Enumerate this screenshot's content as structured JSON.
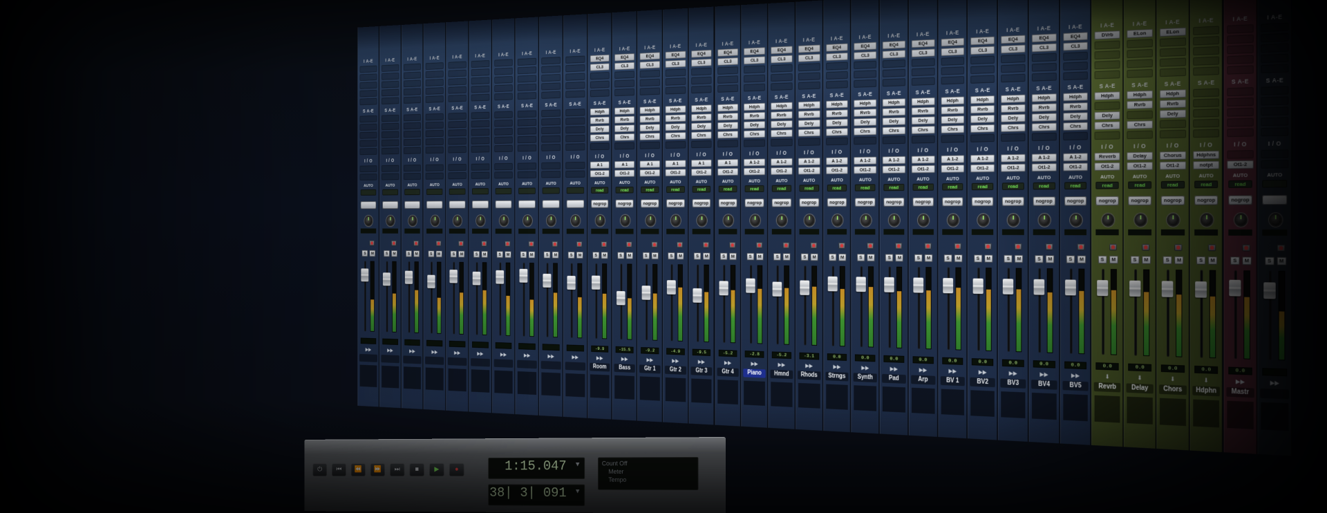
{
  "mixer": {
    "section_labels": {
      "inserts": "I A-E",
      "sends": "S A-E",
      "io": "I / O",
      "auto": "AUTO",
      "solo": "S",
      "mute": "M"
    },
    "channels": [
      {
        "name": "",
        "kind": "audio",
        "inserts": [],
        "sends": [],
        "io_in": "",
        "io_out": "",
        "auto": "",
        "group": "",
        "volume": "",
        "meter": 0.45,
        "fader": 0.8,
        "selected": false
      },
      {
        "name": "",
        "kind": "audio",
        "inserts": [],
        "sends": [],
        "io_in": "",
        "io_out": "",
        "auto": "",
        "group": "",
        "volume": "",
        "meter": 0.55,
        "fader": 0.75,
        "selected": false
      },
      {
        "name": "",
        "kind": "audio",
        "inserts": [],
        "sends": [],
        "io_in": "",
        "io_out": "",
        "auto": "",
        "group": "",
        "volume": "",
        "meter": 0.6,
        "fader": 0.78,
        "selected": false
      },
      {
        "name": "",
        "kind": "audio",
        "inserts": [],
        "sends": [],
        "io_in": "",
        "io_out": "",
        "auto": "",
        "group": "",
        "volume": "",
        "meter": 0.5,
        "fader": 0.72,
        "selected": false
      },
      {
        "name": "",
        "kind": "audio",
        "inserts": [],
        "sends": [],
        "io_in": "",
        "io_out": "",
        "auto": "",
        "group": "",
        "volume": "",
        "meter": 0.58,
        "fader": 0.8,
        "selected": false
      },
      {
        "name": "",
        "kind": "audio",
        "inserts": [],
        "sends": [],
        "io_in": "",
        "io_out": "",
        "auto": "",
        "group": "",
        "volume": "",
        "meter": 0.62,
        "fader": 0.78,
        "selected": false
      },
      {
        "name": "",
        "kind": "audio",
        "inserts": [],
        "sends": [],
        "io_in": "",
        "io_out": "",
        "auto": "",
        "group": "",
        "volume": "",
        "meter": 0.55,
        "fader": 0.8,
        "selected": false
      },
      {
        "name": "",
        "kind": "audio",
        "inserts": [],
        "sends": [],
        "io_in": "",
        "io_out": "",
        "auto": "",
        "group": "",
        "volume": "",
        "meter": 0.5,
        "fader": 0.82,
        "selected": false
      },
      {
        "name": "",
        "kind": "audio",
        "inserts": [],
        "sends": [],
        "io_in": "",
        "io_out": "",
        "auto": "",
        "group": "",
        "volume": "",
        "meter": 0.6,
        "fader": 0.76,
        "selected": false
      },
      {
        "name": "",
        "kind": "audio",
        "inserts": [],
        "sends": [],
        "io_in": "",
        "io_out": "",
        "auto": "",
        "group": "",
        "volume": "",
        "meter": 0.55,
        "fader": 0.74,
        "selected": false
      },
      {
        "name": "Room",
        "kind": "audio",
        "inserts": [
          "EQ4",
          "CL3"
        ],
        "sends": [
          "Hdph",
          "Rvrb",
          "Dely",
          "Chrs"
        ],
        "io_in": "A 1",
        "io_out": "Ot1-2",
        "auto": "read",
        "group": "nogrop",
        "volume": "-9.9",
        "meter": 0.6,
        "fader": 0.75,
        "selected": false
      },
      {
        "name": "Bass",
        "kind": "audio",
        "inserts": [
          "EQ4",
          "CL3"
        ],
        "sends": [
          "Hdph",
          "Rvrb",
          "Dely",
          "Chrs"
        ],
        "io_in": "A 1",
        "io_out": "Ot1-2",
        "auto": "read",
        "group": "nogrop",
        "volume": "-15.5",
        "meter": 0.55,
        "fader": 0.55,
        "selected": false
      },
      {
        "name": "Gtr 1",
        "kind": "audio",
        "inserts": [
          "EQ4",
          "CL3"
        ],
        "sends": [
          "Hdph",
          "Rvrb",
          "Dely",
          "Chrs"
        ],
        "io_in": "A 1",
        "io_out": "Ot1-2",
        "auto": "read",
        "group": "nogrop",
        "volume": "-9.2",
        "meter": 0.62,
        "fader": 0.62,
        "selected": false
      },
      {
        "name": "Gtr 2",
        "kind": "audio",
        "inserts": [
          "EQ4",
          "CL3"
        ],
        "sends": [
          "Hdph",
          "Rvrb",
          "Dely",
          "Chrs"
        ],
        "io_in": "A 1",
        "io_out": "Ot1-2",
        "auto": "read",
        "group": "nogrop",
        "volume": "-4.9",
        "meter": 0.7,
        "fader": 0.7,
        "selected": false
      },
      {
        "name": "Gtr 3",
        "kind": "audio",
        "inserts": [
          "EQ4",
          "CL3"
        ],
        "sends": [
          "Hdph",
          "Rvrb",
          "Dely",
          "Chrs"
        ],
        "io_in": "A 1",
        "io_out": "Ot1-2",
        "auto": "read",
        "group": "nogrop",
        "volume": "-9.5",
        "meter": 0.65,
        "fader": 0.6,
        "selected": false
      },
      {
        "name": "Gtr 4",
        "kind": "audio",
        "inserts": [
          "EQ4",
          "CL3"
        ],
        "sends": [
          "Hdph",
          "Rvrb",
          "Dely",
          "Chrs"
        ],
        "io_in": "A 1",
        "io_out": "Ot1-2",
        "auto": "read",
        "group": "nogrop",
        "volume": "-5.2",
        "meter": 0.68,
        "fader": 0.7,
        "selected": false
      },
      {
        "name": "Piano",
        "kind": "audio",
        "inserts": [
          "EQ4",
          "CL3"
        ],
        "sends": [
          "Hdph",
          "Rvrb",
          "Dely",
          "Chrs"
        ],
        "io_in": "A 1-2",
        "io_out": "Ot1-2",
        "auto": "read",
        "group": "nogrop",
        "volume": "-2.8",
        "meter": 0.7,
        "fader": 0.74,
        "selected": true
      },
      {
        "name": "Hmnd",
        "kind": "audio",
        "inserts": [
          "EQ4",
          "CL3"
        ],
        "sends": [
          "Hdph",
          "Rvrb",
          "Dely",
          "Chrs"
        ],
        "io_in": "A 1-2",
        "io_out": "Ot1-2",
        "auto": "read",
        "group": "nogrop",
        "volume": "-5.2",
        "meter": 0.72,
        "fader": 0.7,
        "selected": false
      },
      {
        "name": "Rhods",
        "kind": "audio",
        "inserts": [
          "EQ4",
          "CL3"
        ],
        "sends": [
          "Hdph",
          "Rvrb",
          "Dely",
          "Chrs"
        ],
        "io_in": "A 1-2",
        "io_out": "Ot1-2",
        "auto": "read",
        "group": "nogrop",
        "volume": "-3.1",
        "meter": 0.74,
        "fader": 0.72,
        "selected": false
      },
      {
        "name": "Strngs",
        "kind": "audio",
        "inserts": [
          "EQ4",
          "CL3"
        ],
        "sends": [
          "Hdph",
          "Rvrb",
          "Dely",
          "Chrs"
        ],
        "io_in": "A 1-2",
        "io_out": "Ot1-2",
        "auto": "read",
        "group": "nogrop",
        "volume": "0.0",
        "meter": 0.72,
        "fader": 0.78,
        "selected": false
      },
      {
        "name": "Synth",
        "kind": "audio",
        "inserts": [
          "EQ4",
          "CL3"
        ],
        "sends": [
          "Hdph",
          "Rvrb",
          "Dely",
          "Chrs"
        ],
        "io_in": "A 1-2",
        "io_out": "Ot1-2",
        "auto": "read",
        "group": "nogrop",
        "volume": "0.0",
        "meter": 0.75,
        "fader": 0.78,
        "selected": false
      },
      {
        "name": "Pad",
        "kind": "audio",
        "inserts": [
          "EQ4",
          "CL3"
        ],
        "sends": [
          "Hdph",
          "Rvrb",
          "Dely",
          "Chrs"
        ],
        "io_in": "A 1-2",
        "io_out": "Ot1-2",
        "auto": "read",
        "group": "nogrop",
        "volume": "0.0",
        "meter": 0.7,
        "fader": 0.78,
        "selected": false
      },
      {
        "name": "Arp",
        "kind": "audio",
        "inserts": [
          "EQ4",
          "CL3"
        ],
        "sends": [
          "Hdph",
          "Rvrb",
          "Dely",
          "Chrs"
        ],
        "io_in": "A 1-2",
        "io_out": "Ot1-2",
        "auto": "read",
        "group": "nogrop",
        "volume": "0.0",
        "meter": 0.72,
        "fader": 0.78,
        "selected": false
      },
      {
        "name": "BV 1",
        "kind": "audio",
        "inserts": [
          "EQ4",
          "CL3"
        ],
        "sends": [
          "Hdph",
          "Rvrb",
          "Dely",
          "Chrs"
        ],
        "io_in": "A 1-2",
        "io_out": "Ot1-2",
        "auto": "read",
        "group": "nogrop",
        "volume": "0.0",
        "meter": 0.76,
        "fader": 0.78,
        "selected": false
      },
      {
        "name": "BV2",
        "kind": "audio",
        "inserts": [
          "EQ4",
          "CL3"
        ],
        "sends": [
          "Hdph",
          "Rvrb",
          "Dely",
          "Chrs"
        ],
        "io_in": "A 1-2",
        "io_out": "Ot1-2",
        "auto": "read",
        "group": "nogrop",
        "volume": "0.0",
        "meter": 0.74,
        "fader": 0.78,
        "selected": false
      },
      {
        "name": "BV3",
        "kind": "audio",
        "inserts": [
          "EQ4",
          "CL3"
        ],
        "sends": [
          "Hdph",
          "Rvrb",
          "Dely",
          "Chrs"
        ],
        "io_in": "A 1-2",
        "io_out": "Ot1-2",
        "auto": "read",
        "group": "nogrop",
        "volume": "0.0",
        "meter": 0.75,
        "fader": 0.78,
        "selected": false
      },
      {
        "name": "BV4",
        "kind": "audio",
        "inserts": [
          "EQ4",
          "CL3"
        ],
        "sends": [
          "Hdph",
          "Rvrb",
          "Dely",
          "Chrs"
        ],
        "io_in": "A 1-2",
        "io_out": "Ot1-2",
        "auto": "read",
        "group": "nogrop",
        "volume": "0.0",
        "meter": 0.72,
        "fader": 0.78,
        "selected": false
      },
      {
        "name": "BV5",
        "kind": "audio",
        "inserts": [
          "EQ4",
          "CL3"
        ],
        "sends": [
          "Hdph",
          "Rvrb",
          "Dely",
          "Chrs"
        ],
        "io_in": "A 1-2",
        "io_out": "Ot1-2",
        "auto": "read",
        "group": "nogrop",
        "volume": "0.0",
        "meter": 0.74,
        "fader": 0.78,
        "selected": false
      },
      {
        "name": "Revrb",
        "kind": "aux",
        "inserts": [
          "DVrb"
        ],
        "sends": [
          "Hdph",
          "",
          "Dely",
          "Chrs"
        ],
        "io_in": "Reverb",
        "io_out": "Ot1-2",
        "auto": "read",
        "group": "nogrop",
        "volume": "0.0",
        "meter": 0.76,
        "fader": 0.78,
        "selected": false
      },
      {
        "name": "Delay",
        "kind": "aux",
        "inserts": [
          "ELon"
        ],
        "sends": [
          "Hdph",
          "Rvrb",
          "",
          "Chrs"
        ],
        "io_in": "Delay",
        "io_out": "Ot1-2",
        "auto": "read",
        "group": "nogrop",
        "volume": "0.0",
        "meter": 0.74,
        "fader": 0.78,
        "selected": false
      },
      {
        "name": "Chors",
        "kind": "aux",
        "inserts": [
          "ELon"
        ],
        "sends": [
          "Hdph",
          "Rvrb",
          "Dely",
          ""
        ],
        "io_in": "Chorus",
        "io_out": "Ot1-2",
        "auto": "read",
        "group": "nogrop",
        "volume": "0.0",
        "meter": 0.72,
        "fader": 0.78,
        "selected": false
      },
      {
        "name": "Hdphn",
        "kind": "aux",
        "inserts": [],
        "sends": [],
        "io_in": "Hdphns",
        "io_out": "notpt",
        "auto": "read",
        "group": "nogrop",
        "volume": "0.0",
        "meter": 0.7,
        "fader": 0.78,
        "selected": false
      },
      {
        "name": "Mastr",
        "kind": "master",
        "inserts": [],
        "sends": [],
        "io_in": "",
        "io_out": "Ot1-2",
        "auto": "read",
        "group": "nogrop",
        "volume": "0.0",
        "meter": 0.7,
        "fader": 0.8,
        "selected": false
      },
      {
        "name": "",
        "kind": "dark",
        "inserts": [],
        "sends": [],
        "io_in": "",
        "io_out": "",
        "auto": "",
        "group": "",
        "volume": "",
        "meter": 0.55,
        "fader": 0.78,
        "selected": false
      }
    ]
  },
  "transport": {
    "main_counter": "1:15.047",
    "sub_counter": "38| 3| 091",
    "info": {
      "count_off": "Count Off",
      "meter": "Meter",
      "tempo": "Tempo"
    }
  }
}
